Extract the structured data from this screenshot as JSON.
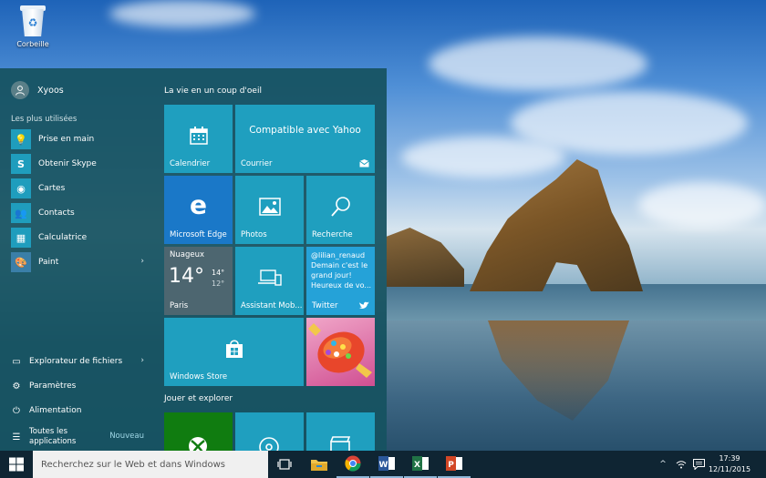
{
  "desktop": {
    "recycle_bin_label": "Corbeille"
  },
  "start_menu": {
    "user_name": "Xyoos",
    "most_used_label": "Les plus utilisées",
    "apps": [
      {
        "label": "Prise en main",
        "icon": "lightbulb-icon"
      },
      {
        "label": "Obtenir Skype",
        "icon": "skype-icon"
      },
      {
        "label": "Cartes",
        "icon": "map-pin-icon"
      },
      {
        "label": "Contacts",
        "icon": "people-icon"
      },
      {
        "label": "Calculatrice",
        "icon": "calculator-icon"
      },
      {
        "label": "Paint",
        "icon": "paint-palette-icon"
      }
    ],
    "system": [
      {
        "label": "Explorateur de fichiers",
        "icon": "folder-icon"
      },
      {
        "label": "Paramètres",
        "icon": "gear-icon"
      },
      {
        "label": "Alimentation",
        "icon": "power-icon"
      }
    ],
    "all_apps_label": "Toutes les applications",
    "new_label": "Nouveau"
  },
  "tiles": {
    "group1_title": "La vie en un coup d'oeil",
    "group2_title": "Jouer et explorer",
    "calendar": "Calendrier",
    "mail": "Courrier",
    "mail_headline": "Compatible avec Yahoo",
    "edge": "Microsoft Edge",
    "photos": "Photos",
    "search": "Recherche",
    "weather_title": "Nuageux",
    "weather_temp": "14°",
    "weather_high": "14°",
    "weather_low": "12°",
    "weather_city": "Paris",
    "phone": "Assistant Mob...",
    "twitter_handle": "@lilian_renaud",
    "twitter_text": "Demain c'est le grand jour! Heureux de vo...",
    "twitter": "Twitter",
    "store": "Windows Store"
  },
  "taskbar": {
    "search_placeholder": "Recherchez sur le Web et dans Windows",
    "time": "17:39",
    "date": "12/11/2015"
  },
  "colors": {
    "tile_blue": "#1f9fbf",
    "edge_blue": "#1a78c8",
    "start_bg": "#165260",
    "taskbar_bg": "#0f2533"
  }
}
